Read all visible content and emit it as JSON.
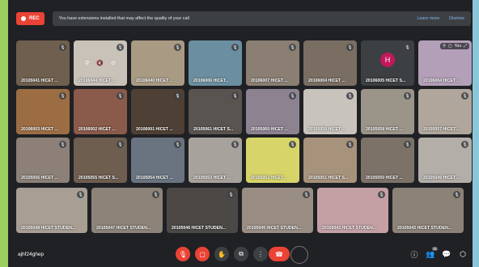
{
  "banner": {
    "rec_label": "REC",
    "message": "You have extensions installed that may affect the quality of your call",
    "learn_more": "Learn more",
    "dismiss": "Dismiss"
  },
  "tiles": [
    {
      "name": "20105041 HICET ...",
      "color": "#6f5f4e"
    },
    {
      "name": "20106044 HICET ...",
      "color": "#c8c2b8"
    },
    {
      "name": "20106040 HICET ...",
      "color": "#a99a83"
    },
    {
      "name": "20106006 HICET...",
      "color": "#6b8fa0"
    },
    {
      "name": "20106007 HICET ...",
      "color": "#8b7f74"
    },
    {
      "name": "20106004 HICET ...",
      "color": "#7a6e63"
    },
    {
      "name": "20106005 HICET S...",
      "color": "#3c4043"
    },
    {
      "name": "20106004 HICET ...",
      "color": "#b39fb8"
    },
    {
      "name": "20106003 HICET ...",
      "color": "#9c6d43"
    },
    {
      "name": "20106002 HICET ...",
      "color": "#8a5a4a"
    },
    {
      "name": "20106001 HICET ...",
      "color": "#4e4034"
    },
    {
      "name": "20105061 HICET S...",
      "color": "#5a5450"
    },
    {
      "name": "20105060 HICET ...",
      "color": "#8c8290"
    },
    {
      "name": "20105059 HICET ...",
      "color": "#c9c3bd"
    },
    {
      "name": "20105058 HICET ...",
      "color": "#9b9488"
    },
    {
      "name": "20105057 HICET ...",
      "color": "#b0a69c"
    },
    {
      "name": "20105056 HICET ...",
      "color": "#8c8078"
    },
    {
      "name": "20105055 HICET S...",
      "color": "#6e5e50"
    },
    {
      "name": "20105054 HICET ...",
      "color": "#6a7480"
    },
    {
      "name": "20105053 HICET ...",
      "color": "#a8a29c"
    },
    {
      "name": "20105052 HICET ...",
      "color": "#d7d56a"
    },
    {
      "name": "20105051 HICET S...",
      "color": "#a7927c"
    },
    {
      "name": "20105050 HICET ...",
      "color": "#7c7268"
    },
    {
      "name": "20105049 HICET ...",
      "color": "#b4aea8"
    },
    {
      "name": "20105048 HICET STUDEN...",
      "color": "#a89e94"
    },
    {
      "name": "20105047 HICET STUDEN...",
      "color": "#8d8378"
    },
    {
      "name": "20105046 HICET STUDEN...",
      "color": "#4c4846"
    },
    {
      "name": "20105045 HICET STUDEN...",
      "color": "#9a8e84"
    },
    {
      "name": "20105043 HICET STUDEN...",
      "color": "#c4a0a4"
    },
    {
      "name": "20105042 HICET STUDEN...",
      "color": "#8c8278"
    }
  ],
  "avatar_letter": "H",
  "self_label": "You",
  "meeting_code": "ajhf24ghep",
  "participant_count": "31"
}
